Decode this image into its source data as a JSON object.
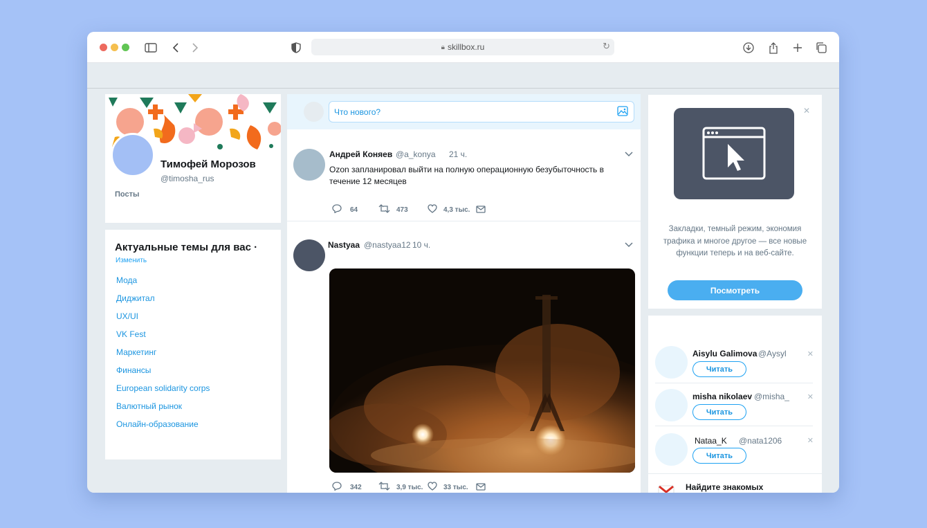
{
  "browser": {
    "url": "skillbox.ru",
    "traffic_colors": [
      "#ed6a5e",
      "#f5bf4f",
      "#61c554"
    ]
  },
  "profile": {
    "name": "Тимофей Морозов",
    "handle": "@timosha_rus",
    "posts_label": "Посты",
    "avatar_color": "#a3bff5"
  },
  "trends": {
    "title": "Актуальные темы для вас ·",
    "change_label": "Изменить",
    "items": [
      "Мода",
      "Диджитал",
      "UX/UI",
      "VK Fest",
      "Маркетинг",
      "Финансы",
      "European solidarity corps",
      "Валютный рынок",
      "Онлайн-образование"
    ]
  },
  "compose": {
    "placeholder": "Что нового?"
  },
  "tweets": [
    {
      "name": "Андрей Коняев",
      "handle": "@a_konya",
      "time": "21 ч.",
      "text": "Ozon запланировал выйти на полную операционную безубыточность в течение 12 месяцев",
      "replies": "64",
      "retweets": "473",
      "likes": "4,3 тыс.",
      "avatar_color": "#a6bccb"
    },
    {
      "name": "Nastyaa",
      "handle": "@nastyaa12",
      "time": "10 ч.",
      "replies": "342",
      "retweets": "3,9 тыс.",
      "likes": "33 тыс.",
      "avatar_color": "#4c5566"
    }
  ],
  "promo": {
    "text": "Закладки, темный режим, экономия трафика и многое другое — все новые функции теперь и на веб-сайте.",
    "button": "Посмотреть"
  },
  "follow": {
    "items": [
      {
        "name": "Aisylu Galimova",
        "handle": "@Aysyl",
        "button": "Читать"
      },
      {
        "name": "misha nikolaev",
        "handle": "@misha_",
        "button": "Читать"
      },
      {
        "name": "Nataa_K",
        "handle": "@nata1206",
        "button": "Читать"
      }
    ],
    "find_label": "Найдите знакомых"
  },
  "colors": {
    "accent": "#1da1f2",
    "page_bg": "#a5c2f7",
    "content_bg": "#e6ecf0"
  }
}
